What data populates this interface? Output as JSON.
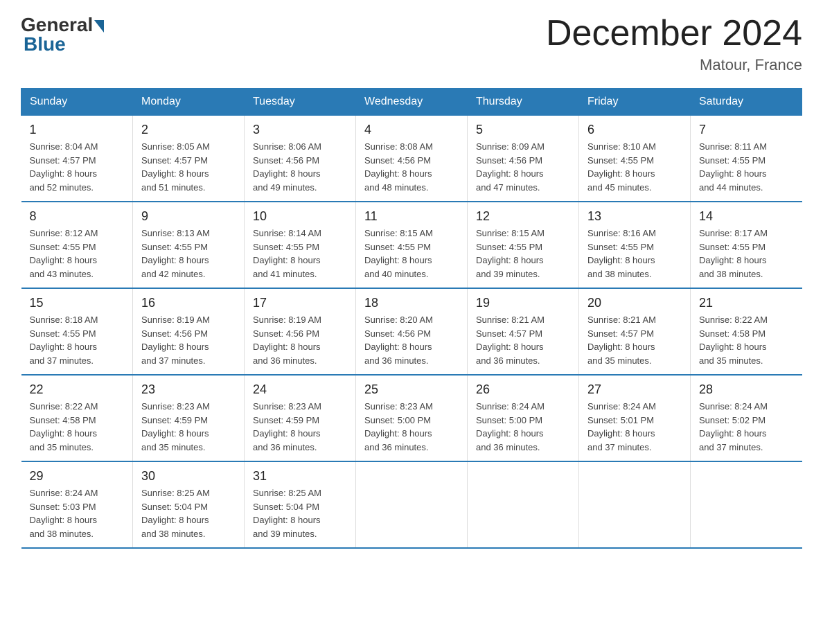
{
  "header": {
    "logo_general": "General",
    "logo_blue": "Blue",
    "title": "December 2024",
    "subtitle": "Matour, France"
  },
  "days_of_week": [
    "Sunday",
    "Monday",
    "Tuesday",
    "Wednesday",
    "Thursday",
    "Friday",
    "Saturday"
  ],
  "weeks": [
    [
      {
        "day": "1",
        "sunrise": "8:04 AM",
        "sunset": "4:57 PM",
        "daylight": "8 hours and 52 minutes."
      },
      {
        "day": "2",
        "sunrise": "8:05 AM",
        "sunset": "4:57 PM",
        "daylight": "8 hours and 51 minutes."
      },
      {
        "day": "3",
        "sunrise": "8:06 AM",
        "sunset": "4:56 PM",
        "daylight": "8 hours and 49 minutes."
      },
      {
        "day": "4",
        "sunrise": "8:08 AM",
        "sunset": "4:56 PM",
        "daylight": "8 hours and 48 minutes."
      },
      {
        "day": "5",
        "sunrise": "8:09 AM",
        "sunset": "4:56 PM",
        "daylight": "8 hours and 47 minutes."
      },
      {
        "day": "6",
        "sunrise": "8:10 AM",
        "sunset": "4:55 PM",
        "daylight": "8 hours and 45 minutes."
      },
      {
        "day": "7",
        "sunrise": "8:11 AM",
        "sunset": "4:55 PM",
        "daylight": "8 hours and 44 minutes."
      }
    ],
    [
      {
        "day": "8",
        "sunrise": "8:12 AM",
        "sunset": "4:55 PM",
        "daylight": "8 hours and 43 minutes."
      },
      {
        "day": "9",
        "sunrise": "8:13 AM",
        "sunset": "4:55 PM",
        "daylight": "8 hours and 42 minutes."
      },
      {
        "day": "10",
        "sunrise": "8:14 AM",
        "sunset": "4:55 PM",
        "daylight": "8 hours and 41 minutes."
      },
      {
        "day": "11",
        "sunrise": "8:15 AM",
        "sunset": "4:55 PM",
        "daylight": "8 hours and 40 minutes."
      },
      {
        "day": "12",
        "sunrise": "8:15 AM",
        "sunset": "4:55 PM",
        "daylight": "8 hours and 39 minutes."
      },
      {
        "day": "13",
        "sunrise": "8:16 AM",
        "sunset": "4:55 PM",
        "daylight": "8 hours and 38 minutes."
      },
      {
        "day": "14",
        "sunrise": "8:17 AM",
        "sunset": "4:55 PM",
        "daylight": "8 hours and 38 minutes."
      }
    ],
    [
      {
        "day": "15",
        "sunrise": "8:18 AM",
        "sunset": "4:55 PM",
        "daylight": "8 hours and 37 minutes."
      },
      {
        "day": "16",
        "sunrise": "8:19 AM",
        "sunset": "4:56 PM",
        "daylight": "8 hours and 37 minutes."
      },
      {
        "day": "17",
        "sunrise": "8:19 AM",
        "sunset": "4:56 PM",
        "daylight": "8 hours and 36 minutes."
      },
      {
        "day": "18",
        "sunrise": "8:20 AM",
        "sunset": "4:56 PM",
        "daylight": "8 hours and 36 minutes."
      },
      {
        "day": "19",
        "sunrise": "8:21 AM",
        "sunset": "4:57 PM",
        "daylight": "8 hours and 36 minutes."
      },
      {
        "day": "20",
        "sunrise": "8:21 AM",
        "sunset": "4:57 PM",
        "daylight": "8 hours and 35 minutes."
      },
      {
        "day": "21",
        "sunrise": "8:22 AM",
        "sunset": "4:58 PM",
        "daylight": "8 hours and 35 minutes."
      }
    ],
    [
      {
        "day": "22",
        "sunrise": "8:22 AM",
        "sunset": "4:58 PM",
        "daylight": "8 hours and 35 minutes."
      },
      {
        "day": "23",
        "sunrise": "8:23 AM",
        "sunset": "4:59 PM",
        "daylight": "8 hours and 35 minutes."
      },
      {
        "day": "24",
        "sunrise": "8:23 AM",
        "sunset": "4:59 PM",
        "daylight": "8 hours and 36 minutes."
      },
      {
        "day": "25",
        "sunrise": "8:23 AM",
        "sunset": "5:00 PM",
        "daylight": "8 hours and 36 minutes."
      },
      {
        "day": "26",
        "sunrise": "8:24 AM",
        "sunset": "5:00 PM",
        "daylight": "8 hours and 36 minutes."
      },
      {
        "day": "27",
        "sunrise": "8:24 AM",
        "sunset": "5:01 PM",
        "daylight": "8 hours and 37 minutes."
      },
      {
        "day": "28",
        "sunrise": "8:24 AM",
        "sunset": "5:02 PM",
        "daylight": "8 hours and 37 minutes."
      }
    ],
    [
      {
        "day": "29",
        "sunrise": "8:24 AM",
        "sunset": "5:03 PM",
        "daylight": "8 hours and 38 minutes."
      },
      {
        "day": "30",
        "sunrise": "8:25 AM",
        "sunset": "5:04 PM",
        "daylight": "8 hours and 38 minutes."
      },
      {
        "day": "31",
        "sunrise": "8:25 AM",
        "sunset": "5:04 PM",
        "daylight": "8 hours and 39 minutes."
      },
      null,
      null,
      null,
      null
    ]
  ],
  "labels": {
    "sunrise_prefix": "Sunrise: ",
    "sunset_prefix": "Sunset: ",
    "daylight_prefix": "Daylight: "
  }
}
